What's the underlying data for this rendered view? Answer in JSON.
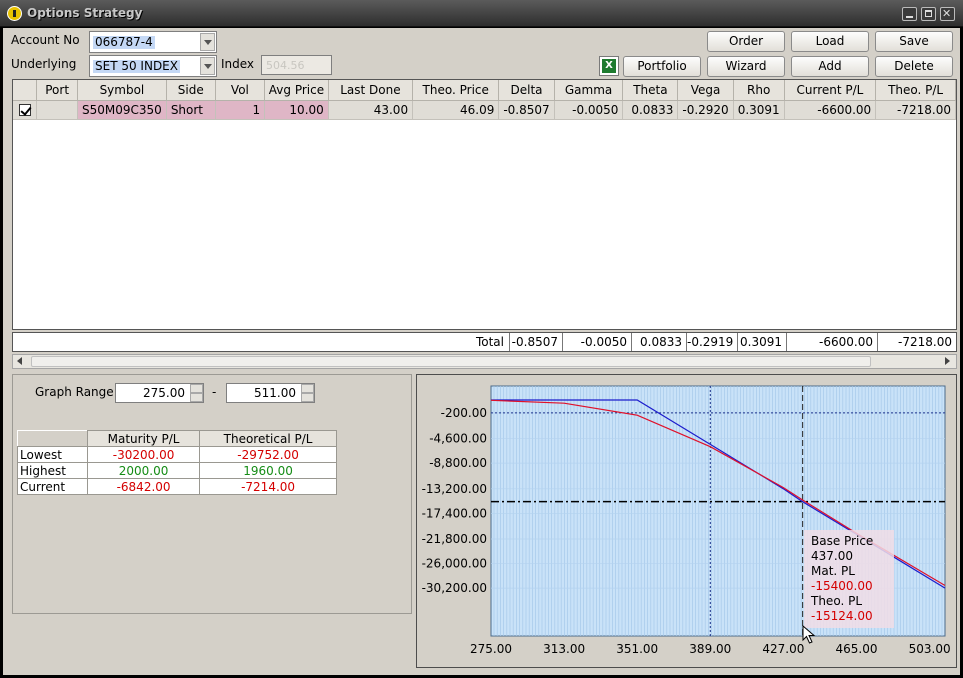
{
  "window": {
    "title": "Options Strategy"
  },
  "form": {
    "account_label": "Account No",
    "account_value": "066787-4",
    "underlying_label": "Underlying",
    "underlying_value": "SET 50 INDEX",
    "index_label": "Index",
    "index_value": "504.56"
  },
  "toolbar": {
    "order": "Order",
    "load": "Load",
    "save": "Save",
    "portfolio": "Portfolio",
    "wizard": "Wizard",
    "add": "Add",
    "delete": "Delete",
    "excel_icon": "excel-icon"
  },
  "grid": {
    "columns": [
      "Port",
      "Symbol",
      "Side",
      "Vol",
      "Avg Price",
      "Last Done",
      "Theo. Price",
      "Delta",
      "Gamma",
      "Theta",
      "Vega",
      "Rho",
      "Current P/L",
      "Theo. P/L"
    ],
    "rows": [
      {
        "checked": true,
        "port": "",
        "symbol": "S50M09C350",
        "side": "Short",
        "vol": "1",
        "avg_price": "10.00",
        "last_done": "43.00",
        "theo_price": "46.09",
        "delta": "-0.8507",
        "gamma": "-0.0050",
        "theta": "0.0833",
        "vega": "-0.2920",
        "rho": "0.3091",
        "current_pl": "-6600.00",
        "theo_pl": "-7218.00"
      }
    ],
    "total": {
      "label": "Total",
      "delta": "-0.8507",
      "gamma": "-0.0050",
      "theta": "0.0833",
      "vega": "-0.2919",
      "rho": "0.3091",
      "current_pl": "-6600.00",
      "theo_pl": "-7218.00"
    }
  },
  "graph_range": {
    "label": "Graph Range",
    "from": "275.00",
    "dash": "-",
    "to": "511.00"
  },
  "pl_table": {
    "headers": [
      "Maturity P/L",
      "Theoretical P/L"
    ],
    "rows": [
      {
        "label": "Lowest",
        "maturity": "-30200.00",
        "theoretical": "-29752.00",
        "color": "red"
      },
      {
        "label": "Highest",
        "maturity": "2000.00",
        "theoretical": "1960.00",
        "color": "green"
      },
      {
        "label": "Current",
        "maturity": "-6842.00",
        "theoretical": "-7214.00",
        "color": "red"
      }
    ]
  },
  "chart_data": {
    "type": "line",
    "x_ticks": [
      "275.00",
      "313.00",
      "351.00",
      "389.00",
      "427.00",
      "465.00",
      "503.00"
    ],
    "y_ticks": [
      "-200.00",
      "-4,600.00",
      "-8,800.00",
      "-13,200.00",
      "-17,400.00",
      "-21,800.00",
      "-26,000.00",
      "-30,200.00"
    ],
    "xlim": [
      275,
      511
    ],
    "series": [
      {
        "color": "#1c1ccc",
        "x": [
          275,
          351,
          389,
          427,
          437,
          465,
          511
        ],
        "y": [
          2000,
          2000,
          -5600,
          -13200,
          -15400,
          -21000,
          -30200
        ]
      },
      {
        "color": "#e0102a",
        "x": [
          275,
          313,
          351,
          389,
          427,
          437,
          465,
          511
        ],
        "y": [
          1960,
          1450,
          -600,
          -6000,
          -13000,
          -15124,
          -20800,
          -29752
        ]
      }
    ],
    "reference_lines": {
      "current_index": 504.56,
      "base_price_x": 437,
      "dashdot_y": -15400
    },
    "tooltip": {
      "base_label": "Base Price",
      "base_value": "437.00",
      "mat_label": "Mat. PL",
      "mat_value": "-15400.00",
      "theo_label": "Theo. PL",
      "theo_value": "-15124.00"
    }
  }
}
